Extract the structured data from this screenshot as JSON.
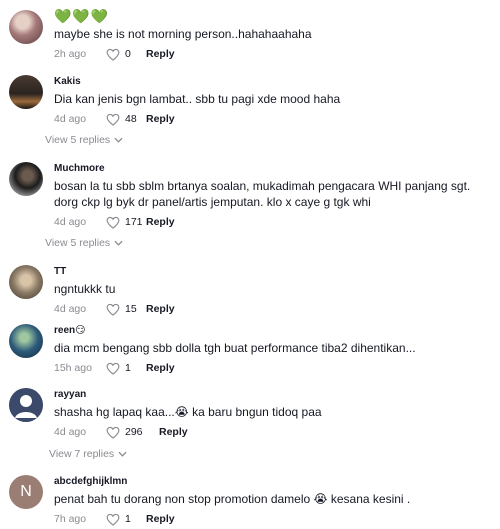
{
  "comments": [
    {
      "username": "💚💚💚",
      "text": "maybe she is not morning person..hahahaahaha",
      "time": "2h ago",
      "likes": "0",
      "reply": "Reply",
      "avatar_color": "#a57a7a"
    },
    {
      "username": "Kakis",
      "text": "Dia kan jenis bgn lambat.. sbb tu pagi xde mood haha",
      "time": "4d ago",
      "likes": "48",
      "reply": "Reply",
      "view_replies": "View 5 replies",
      "avatar_color": "#2a2420"
    },
    {
      "username": "Muchmore",
      "text": "bosan la tu sbb sblm brtanya soalan, mukadimah pengacara WHI panjang sgt. dorg ckp lg byk dr panel/artis jemputan. klo x caye g tgk whi",
      "time": "4d ago",
      "likes": "171",
      "reply": "Reply",
      "view_replies": "View 5 replies",
      "avatar_color": "#1c1c1c"
    },
    {
      "username": "TT",
      "text": "ngntukkk tu",
      "time": "4d ago",
      "likes": "15",
      "reply": "Reply",
      "avatar_color": "#8b7a66"
    },
    {
      "username": "reen😏",
      "text": "dia mcm bengang sbb dolla tgh buat performance tiba2 dihentikan...",
      "time": "15h ago",
      "likes": "1",
      "reply": "Reply",
      "avatar_color": "#2d5a7a"
    },
    {
      "username": "rayyan",
      "text": "shasha hg lapaq kaa...😭 ka baru bngun tidoq paa",
      "time": "4d ago",
      "likes": "296",
      "reply": "Reply",
      "view_replies": "View 7 replies",
      "avatar_color": "#3b4a6b"
    },
    {
      "username": "abcdefghijklmn",
      "text": "penat bah tu dorang non stop promotion damelo 😭 kesana kesini .",
      "time": "7h ago",
      "likes": "1",
      "reply": "Reply",
      "avatar_letter": "N",
      "avatar_color": "#9a7d73"
    }
  ],
  "icons": {
    "like": "heart-outline-icon",
    "expand": "chevron-down-icon"
  }
}
